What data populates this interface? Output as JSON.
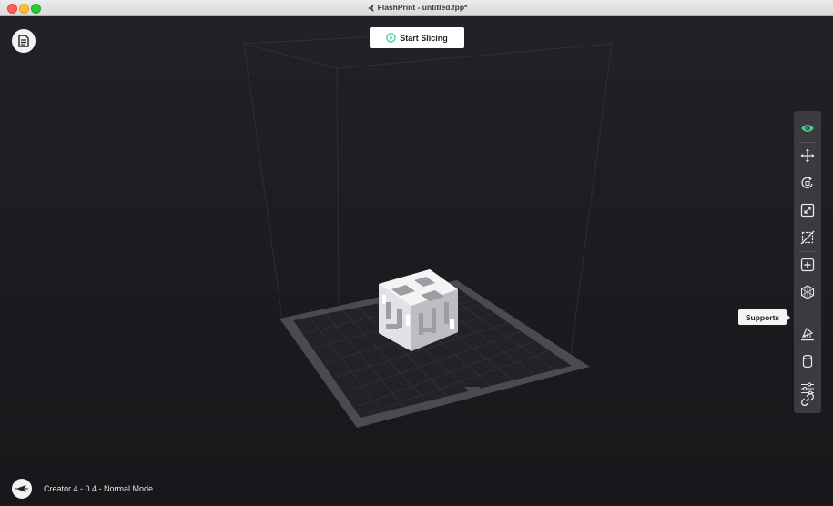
{
  "window": {
    "title": "FlashPrint - untitled.fpp*"
  },
  "header": {
    "start_slicing_label": "Start Slicing"
  },
  "toolbar": {
    "tools": [
      {
        "name": "view",
        "icon": "eye-icon",
        "active": true
      },
      {
        "name": "move",
        "icon": "move-icon"
      },
      {
        "name": "rotate",
        "icon": "rotate-icon"
      },
      {
        "name": "scale",
        "icon": "scale-icon"
      },
      {
        "name": "cut",
        "icon": "cut-icon"
      },
      {
        "name": "add",
        "icon": "add-model-icon"
      },
      {
        "name": "repair",
        "icon": "mesh-icon"
      },
      {
        "name": "supports",
        "icon": "supports-icon"
      },
      {
        "name": "raft",
        "icon": "cylinder-icon"
      },
      {
        "name": "settings",
        "icon": "sliders-icon"
      },
      {
        "name": "link",
        "icon": "link-icon"
      }
    ],
    "tooltip": "Supports"
  },
  "status": {
    "printer_text": "Creator 4 - 0.4 - Normal Mode"
  },
  "colors": {
    "accent": "#3ecf8e",
    "background": "#1b1b1f",
    "toolbar": "#3a3a3f"
  }
}
